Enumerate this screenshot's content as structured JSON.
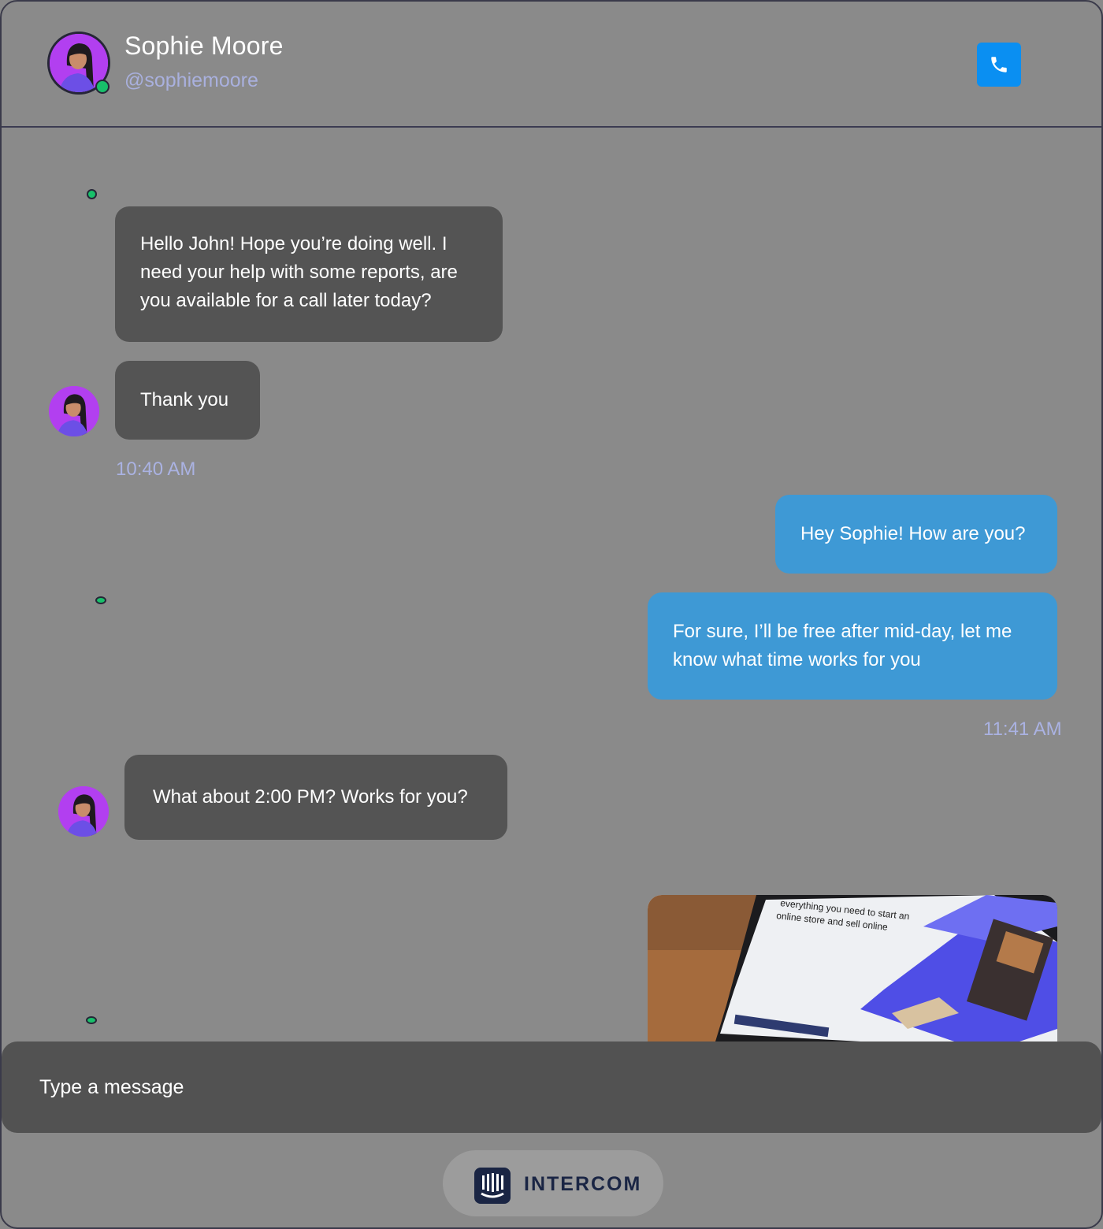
{
  "contact": {
    "name": "Sophie Moore",
    "handle": "@sophiemoore"
  },
  "messages": [
    {
      "direction": "in",
      "text": "Hello John! Hope you’re doing well. I need your help with some reports, are you available for a call later today?"
    },
    {
      "direction": "in",
      "text": "Thank you"
    },
    {
      "direction": "out",
      "text": "Hey Sophie! How are you?"
    },
    {
      "direction": "out",
      "text": "For sure, I’ll be free after mid-day, let me know what time works for you"
    },
    {
      "direction": "in",
      "text": "What about 2:00 PM? Works for you?"
    }
  ],
  "timestamps": [
    "10:40 AM",
    "11:41 AM"
  ],
  "image_message": {
    "caption_line1": "everything you need to start an",
    "caption_line2": "online store and sell online"
  },
  "input": {
    "placeholder": "Type a message"
  },
  "brand": {
    "name": "INTERCOM"
  },
  "colors": {
    "incoming_bubble": "#545454",
    "outgoing_bubble": "#3e99d5",
    "call_button": "#0a8ff2",
    "online_status": "#18c06a"
  }
}
